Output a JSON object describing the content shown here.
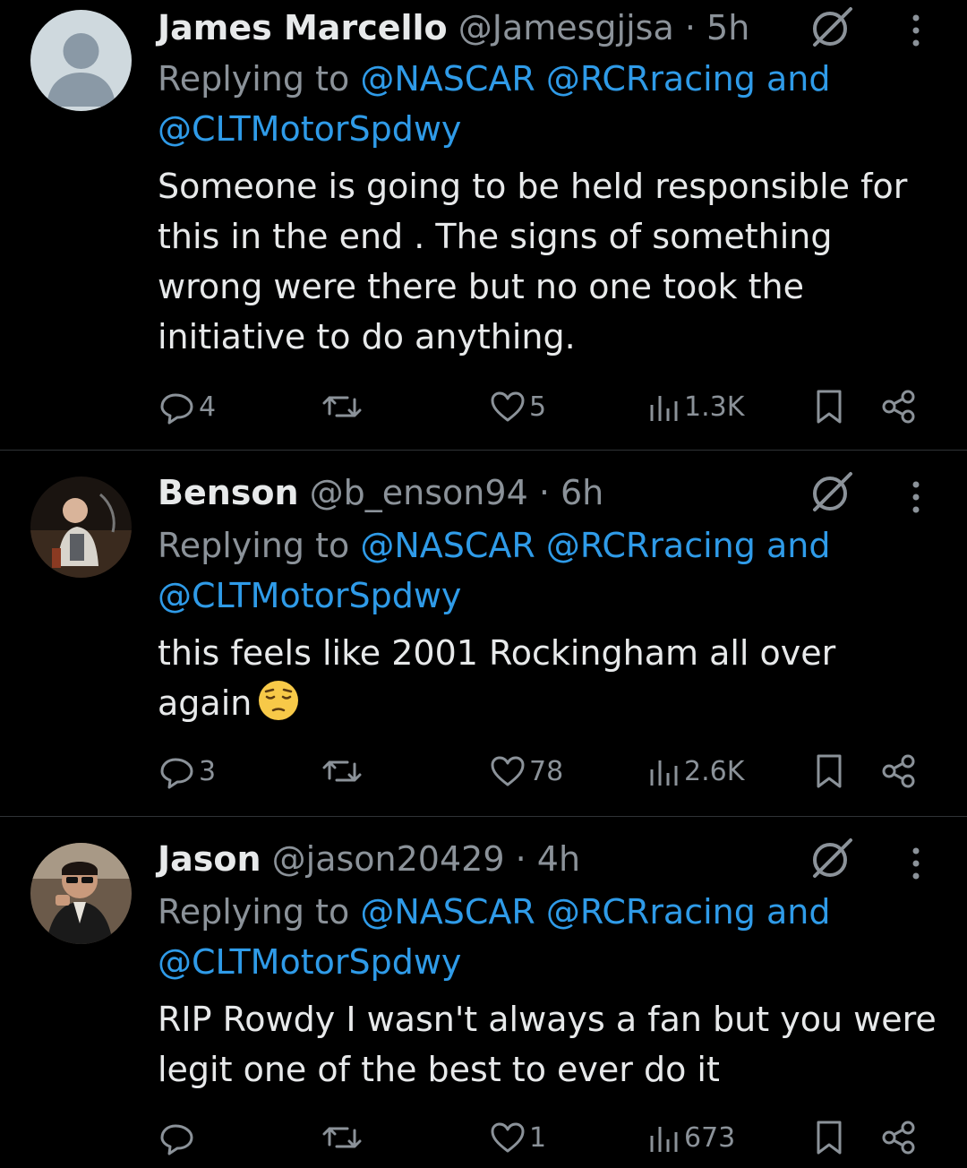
{
  "tweets": [
    {
      "name": "James Marcello",
      "handle": "@Jamesgjjsa",
      "time": "· 5h",
      "reply_prefix": "Replying to ",
      "reply_mentions_1": "@NASCAR @RCRracing and",
      "reply_mentions_2": "@CLTMotorSpdwy",
      "text": "Someone is going to be held responsible for this in the end . The signs of something wrong were there but no one took the initiative to do anything.",
      "replies": "4",
      "reposts": "",
      "likes": "5",
      "views": "1.3K"
    },
    {
      "name": "Benson",
      "handle": "@b_enson94",
      "time": "· 6h",
      "reply_prefix": "Replying to ",
      "reply_mentions_1": "@NASCAR @RCRracing and",
      "reply_mentions_2": "@CLTMotorSpdwy",
      "text": "this feels like 2001 Rockingham all over again",
      "emoji": "pensive-face",
      "replies": "3",
      "reposts": "",
      "likes": "78",
      "views": "2.6K"
    },
    {
      "name": "Jason",
      "handle": "@jason20429",
      "time": "· 4h",
      "reply_prefix": "Replying to ",
      "reply_mentions_1": "@NASCAR @RCRracing and",
      "reply_mentions_2": "@CLTMotorSpdwy",
      "text": "RIP Rowdy I wasn't always a fan but you were legit one of the best to ever do it",
      "replies": "",
      "reposts": "",
      "likes": "1",
      "views": "673"
    }
  ],
  "colors": {
    "background": "#000000",
    "text": "#e7e9ea",
    "muted": "#8b9299",
    "link": "#2f9be8",
    "divider": "#2f3336"
  }
}
